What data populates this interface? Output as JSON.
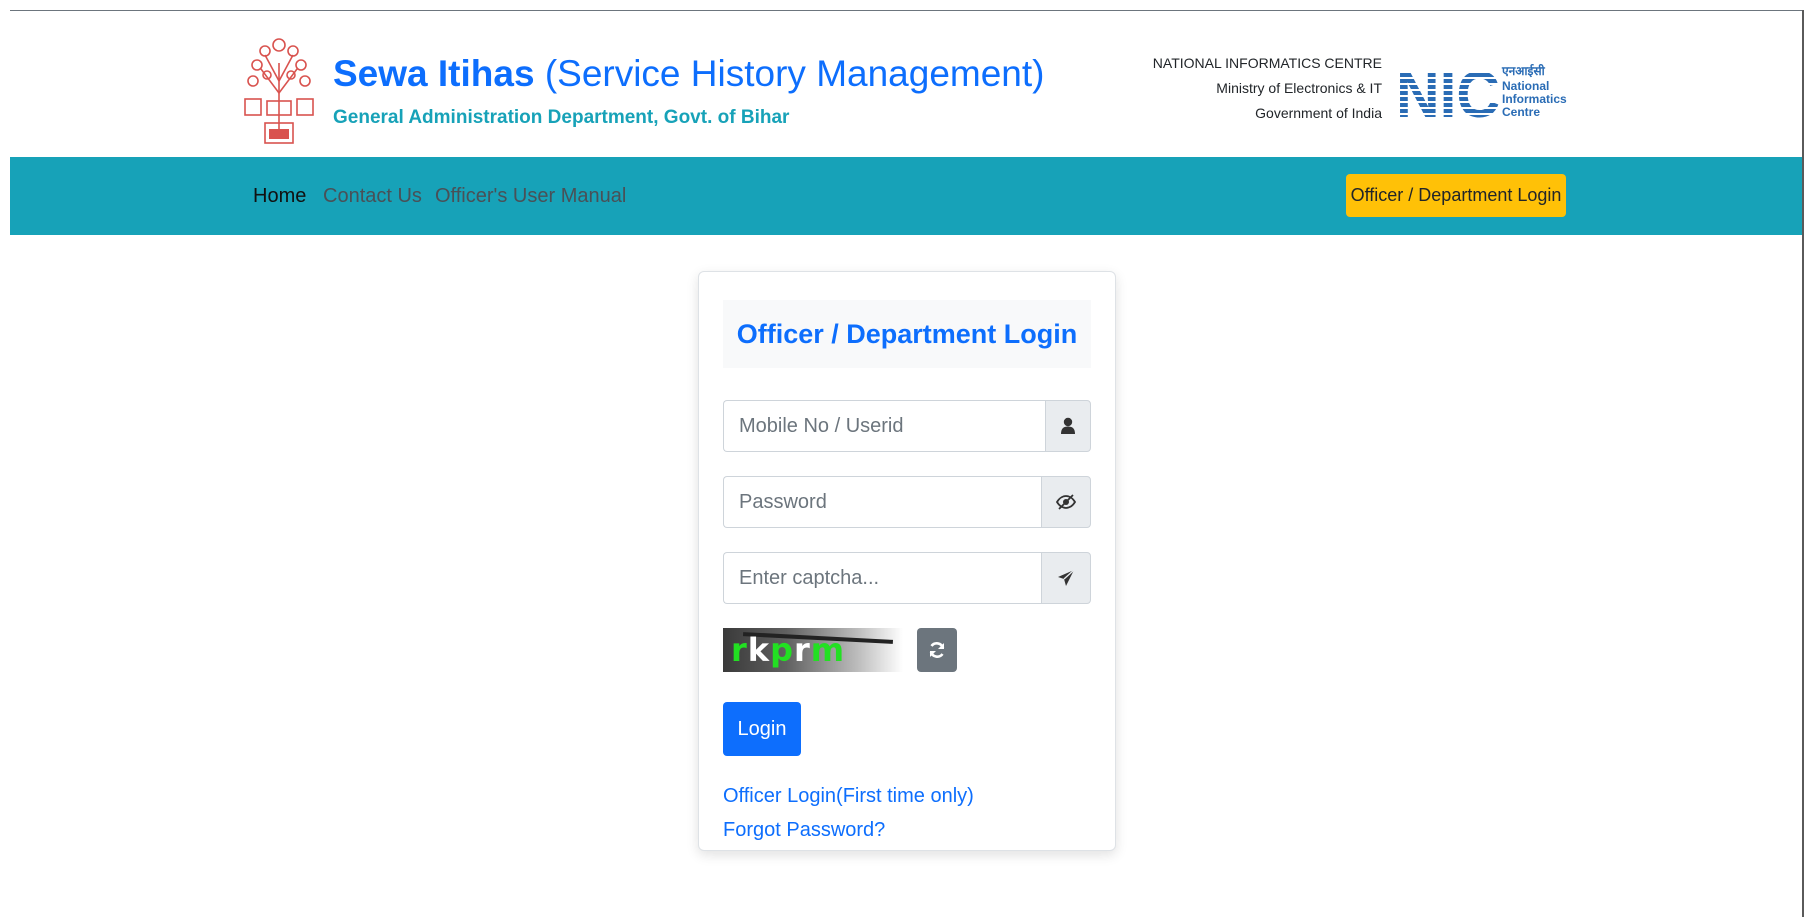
{
  "header": {
    "title_bold": "Sewa Itihas",
    "title_rest": "(Service History Management)",
    "subtitle": "General Administration Department, Govt. of Bihar",
    "nic_lines": [
      "NATIONAL INFORMATICS CENTRE",
      "Ministry of Electronics & IT",
      "Government of India"
    ],
    "nic_logo_text": "NIC",
    "nic_logo_hindi": "एनआईसी",
    "nic_logo_lines": [
      "National",
      "Informatics",
      "Centre"
    ]
  },
  "navbar": {
    "links": [
      "Home",
      "Contact Us",
      "Officer's User Manual"
    ],
    "login_button": "Officer / Department Login"
  },
  "login_card": {
    "heading": "Officer / Department Login",
    "userid_placeholder": "Mobile No / Userid",
    "password_placeholder": "Password",
    "captcha_placeholder": "Enter captcha...",
    "captcha_chars": [
      "r",
      "k",
      "p",
      "r",
      "m"
    ],
    "login_label": "Login",
    "first_time_link": "Officer Login(First time only)",
    "forgot_link": "Forgot Password?"
  },
  "colors": {
    "primary": "#0d6efd",
    "navbar": "#17a2b8",
    "warning": "#ffc107",
    "captcha_text": "#22e022"
  },
  "icons": {
    "user": "user-icon",
    "password_toggle": "eye-slash-icon",
    "captcha_submit": "paper-plane-icon",
    "refresh": "refresh-icon"
  }
}
